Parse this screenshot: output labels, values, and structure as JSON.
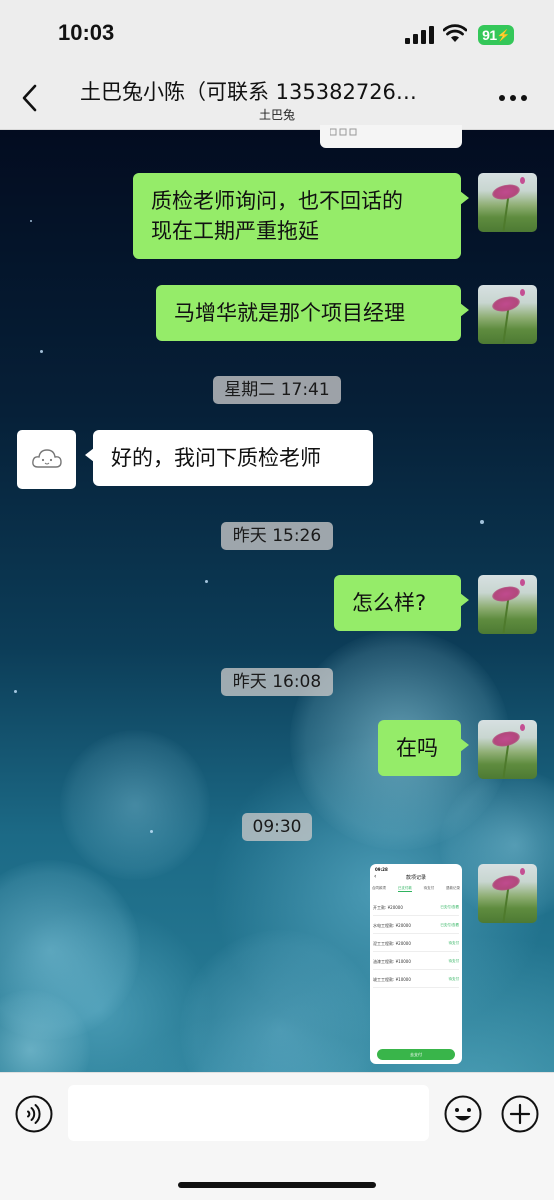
{
  "status_bar": {
    "time": "10:03",
    "battery": "91"
  },
  "header": {
    "title": "土巴兔小陈（可联系 135382726…",
    "subtitle": "土巴兔"
  },
  "messages": [
    {
      "direction": "out",
      "text_line1": "质检老师询问，也不回话的",
      "text_line2": "现在工期严重拖延"
    },
    {
      "direction": "out",
      "text": "马增华就是那个项目经理"
    },
    {
      "timestamp": "星期二 17:41"
    },
    {
      "direction": "in",
      "text": "好的，我问下质检老师"
    },
    {
      "timestamp": "昨天 15:26"
    },
    {
      "direction": "out",
      "text": "怎么样?"
    },
    {
      "timestamp": "昨天 16:08"
    },
    {
      "direction": "out",
      "text": "在吗"
    },
    {
      "timestamp": "09:30"
    },
    {
      "direction": "out",
      "type": "image",
      "thumbnail": {
        "time": "09:28",
        "title": "款项记录",
        "tabs": [
          "合同款项",
          "已支付款",
          "待支付",
          "退款记录"
        ],
        "rows": [
          {
            "label": "开工款: ¥20000",
            "action": "已支付/查看"
          },
          {
            "label": "水电工程款: ¥20000",
            "action": "已支付/查看"
          },
          {
            "label": "泥工工程款: ¥20000",
            "action": "待支付"
          },
          {
            "label": "油漆工程款: ¥10000",
            "action": "待支付"
          },
          {
            "label": "竣工工程款: ¥10000",
            "action": "待支付"
          }
        ],
        "button": "去支付"
      }
    }
  ],
  "input_bar": {
    "text_value": "",
    "placeholder": ""
  },
  "colors": {
    "outgoing_bubble": "#95ec69",
    "incoming_bubble": "#ffffff",
    "header_bg": "#ededed",
    "battery": "#34c759"
  }
}
